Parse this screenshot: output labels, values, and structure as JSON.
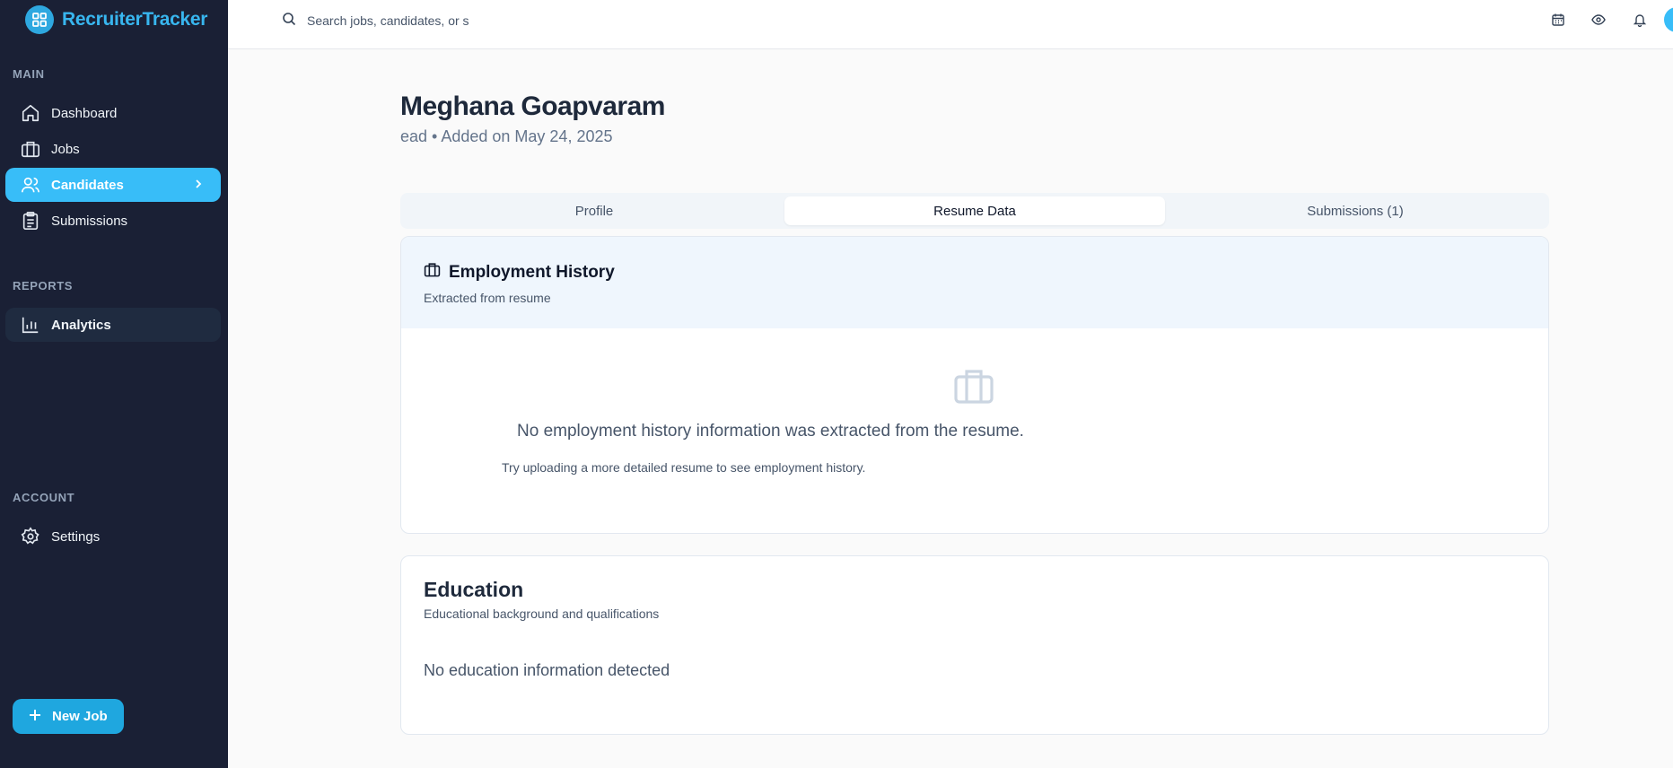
{
  "app": {
    "name": "RecruiterTracker"
  },
  "sidebar": {
    "sections": [
      {
        "label": "MAIN"
      },
      {
        "label": "REPORTS"
      },
      {
        "label": "ACCOUNT"
      }
    ],
    "items": [
      {
        "label": "Dashboard",
        "icon": "home-icon"
      },
      {
        "label": "Jobs",
        "icon": "briefcase-icon"
      },
      {
        "label": "Candidates",
        "icon": "users-icon",
        "active": true
      },
      {
        "label": "Submissions",
        "icon": "clipboard-icon"
      },
      {
        "label": "Analytics",
        "icon": "bar-chart-icon"
      },
      {
        "label": "Settings",
        "icon": "gear-icon"
      }
    ],
    "new_job_label": "New Job"
  },
  "header": {
    "search_placeholder": "Search jobs, candidates, or s"
  },
  "candidate": {
    "name": "Meghana Goapvaram",
    "subtitle": "ead • Added on May 24, 2025"
  },
  "tabs": [
    {
      "label": "Profile"
    },
    {
      "label": "Resume Data",
      "active": true
    },
    {
      "label": "Submissions (1)"
    }
  ],
  "employment": {
    "title": "Employment History",
    "description": "Extracted from resume",
    "empty_message": "No employment history information was extracted from the resume.",
    "empty_hint": "Try uploading a more detailed resume to see employment history."
  },
  "education": {
    "title": "Education",
    "description": "Educational background and qualifications",
    "empty_message": "No education information detected"
  },
  "colors": {
    "sidebar_bg": "#1a2035",
    "accent": "#38bdf8",
    "brand": "#38b6ef",
    "button": "#1fa7df"
  }
}
